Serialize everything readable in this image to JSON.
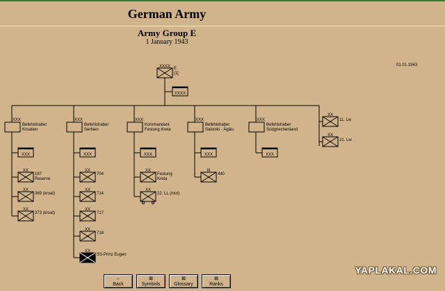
{
  "header": {
    "title": "German Army",
    "subtitle": "Army Group E",
    "date": "1 January 1943",
    "corner_date": "01.01.1943"
  },
  "top": {
    "strength": "XXXX",
    "label": "E",
    "sub": "[1]",
    "hq_strength": "XXXX"
  },
  "columns": [
    {
      "strength": "XXX",
      "lines": [
        "Befehlshaber",
        "Kroatien"
      ],
      "hq": "XXX",
      "units": [
        {
          "strength": "XX",
          "lines": [
            "187",
            "Reserve"
          ]
        },
        {
          "strength": "XX",
          "lines": [
            "369 (kroat)"
          ]
        },
        {
          "strength": "XX",
          "lines": [
            "373 (kroat)"
          ]
        }
      ]
    },
    {
      "strength": "XXX",
      "lines": [
        "Befehlshaber",
        "Serbien"
      ],
      "hq": "XXX",
      "units": [
        {
          "strength": "XX",
          "lines": [
            "704"
          ]
        },
        {
          "strength": "XX",
          "lines": [
            "714"
          ]
        },
        {
          "strength": "XX",
          "lines": [
            "717"
          ]
        },
        {
          "strength": "XX",
          "lines": [
            "718"
          ]
        },
        {
          "strength": "XX",
          "lines": [
            "SS-Prinz Eugen"
          ],
          "dark": true
        }
      ]
    },
    {
      "strength": "XXX",
      "lines": [
        "Kommandant",
        "Festung Kreta"
      ],
      "hq": "XXX",
      "units": [
        {
          "strength": "XX",
          "lines": [
            "Festung",
            "Kreta"
          ]
        },
        {
          "strength": "XX",
          "lines": [
            "22. LL (mot)"
          ],
          "wheels": true
        }
      ]
    },
    {
      "strength": "XXX",
      "lines": [
        "Befehlshaber",
        "Saloniki - Ägäis"
      ],
      "hq": "XXX",
      "units": [
        {
          "strength": "III",
          "lines": [
            "440"
          ]
        }
      ]
    },
    {
      "strength": "XXX",
      "lines": [
        "Befehlshaber",
        "Südgriechenland"
      ],
      "hq": "XXX",
      "units": []
    }
  ],
  "luftwaffe": [
    {
      "strength": "XX",
      "label": "11. Lw"
    },
    {
      "strength": "XX",
      "label": "21. Lw"
    }
  ],
  "nav": {
    "back": "Back",
    "symbols": "Symbols",
    "glossary": "Glossary",
    "ranks": "Ranks"
  },
  "watermark": "YAPLAKAL.COM",
  "colors": {
    "background": "#d2b48c",
    "line": "#000000"
  }
}
